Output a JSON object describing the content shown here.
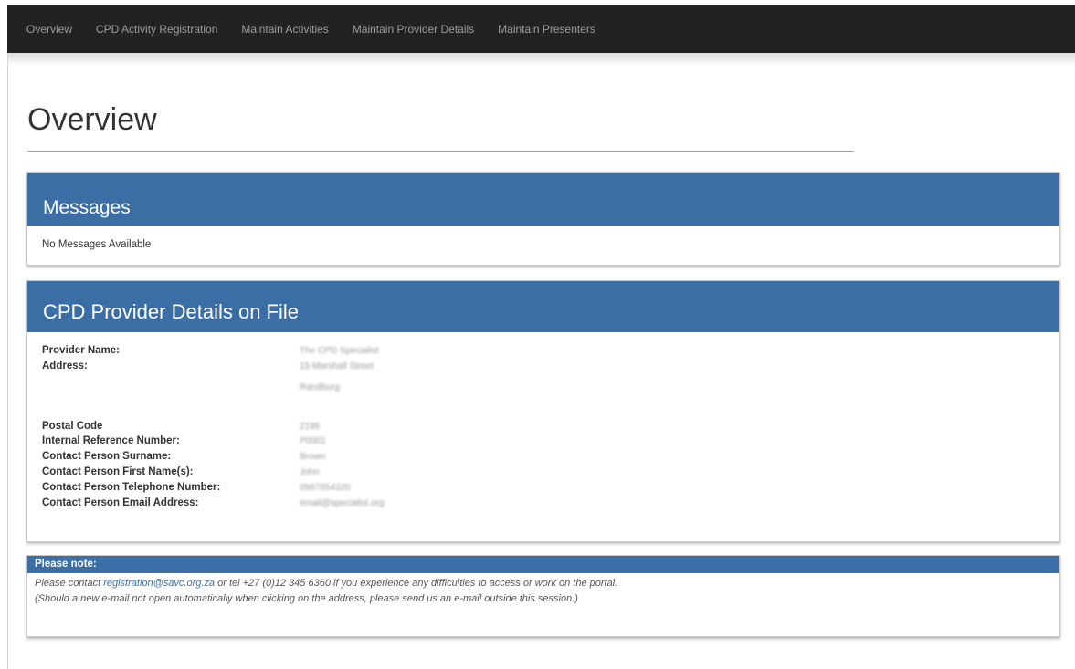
{
  "nav": {
    "items": [
      "Overview",
      "CPD Activity Registration",
      "Maintain Activities",
      "Maintain Provider Details",
      "Maintain Presenters"
    ]
  },
  "page": {
    "title": "Overview"
  },
  "messages": {
    "heading": "Messages",
    "body": "No Messages Available"
  },
  "provider": {
    "heading": "CPD Provider Details on File",
    "labels": {
      "provider_name": "Provider Name:",
      "address": "Address:",
      "postal_code": "Postal Code",
      "internal_ref": "Internal Reference Number:",
      "surname": "Contact Person Surname:",
      "first_names": "Contact Person First Name(s):",
      "telephone": "Contact Person Telephone Number:",
      "email": "Contact Person Email Address:"
    },
    "values": {
      "provider_name": "The CPD Specialist",
      "address_line1": "15 Marshall Street",
      "address_line2": "Randburg",
      "postal_code": "2195",
      "internal_ref": "P0001",
      "surname": "Brown",
      "first_names": "John",
      "telephone": "0987654320",
      "email": "email@specialist.org"
    }
  },
  "note": {
    "heading": "Please note:",
    "line1_prefix": "Please contact ",
    "email_link": "registration@savc.org.za",
    "line1_suffix": " or tel +27 (0)12 345 6360 if you experience any difficulties to access or work on the portal.",
    "line2": "(Should a new e-mail not open automatically when clicking on the address, please send us an e-mail outside this session.)"
  },
  "colors": {
    "navbar": "#222222",
    "panel_heading": "#3a6ea5"
  }
}
